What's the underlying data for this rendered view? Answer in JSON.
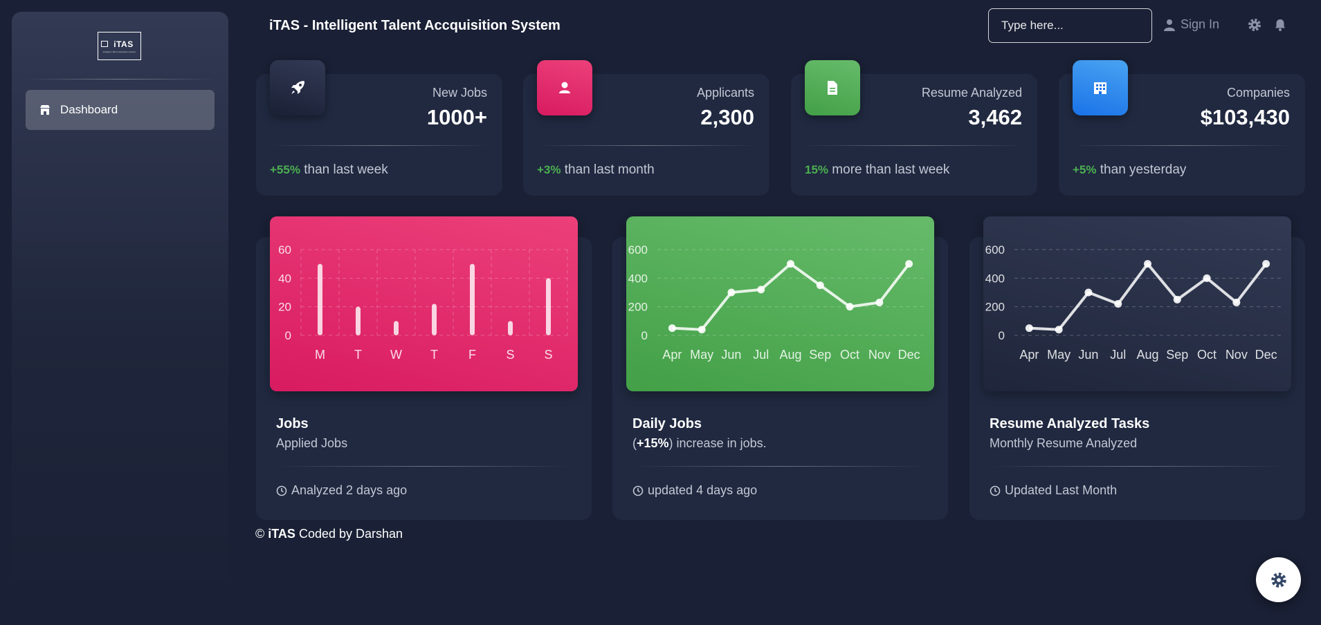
{
  "sidebar": {
    "logo_text": "iTAS",
    "logo_subtext": "Intelligent Talent Acquisition System",
    "items": [
      {
        "label": "Dashboard",
        "icon": "shop-icon",
        "active": true
      }
    ]
  },
  "header": {
    "title": "iTAS - Intelligent Talent Accquisition System",
    "search_placeholder": "Type here...",
    "signin_label": "Sign In",
    "icons": [
      "user-icon",
      "gear-icon",
      "bell-icon"
    ]
  },
  "stats": [
    {
      "label": "New Jobs",
      "value": "1000+",
      "pct": "+55%",
      "foot": " than last week",
      "icon": "rocket-icon",
      "color": "#2a3044"
    },
    {
      "label": "Applicants",
      "value": "2,300",
      "pct": "+3%",
      "foot": " than last month",
      "icon": "person-icon",
      "color": "#e91e63"
    },
    {
      "label": "Resume Analyzed",
      "value": "3,462",
      "pct": "15%",
      "foot": " more than last week",
      "icon": "document-icon",
      "color": "#4caf50"
    },
    {
      "label": "Companies",
      "value": "$103,430",
      "pct": "+5%",
      "foot": " than yesterday",
      "icon": "building-icon",
      "color": "#1a73e8"
    }
  ],
  "charts": [
    {
      "title": "Jobs",
      "subtitle": "Applied Jobs",
      "footer": "Analyzed 2 days ago"
    },
    {
      "title": "Daily Jobs",
      "subtitle_pre": "(",
      "subtitle_bold": "+15%",
      "subtitle_post": ") increase in jobs.",
      "footer": "updated 4 days ago"
    },
    {
      "title": "Resume Analyzed Tasks",
      "subtitle": "Monthly Resume Analyzed",
      "footer": "Updated Last Month"
    }
  ],
  "chart_data": [
    {
      "type": "bar",
      "categories": [
        "M",
        "T",
        "W",
        "T",
        "F",
        "S",
        "S"
      ],
      "values": [
        50,
        20,
        10,
        22,
        50,
        10,
        40
      ],
      "ylim": [
        0,
        60
      ],
      "yticks": [
        0,
        20,
        40,
        60
      ],
      "background": "#e91e63"
    },
    {
      "type": "line",
      "categories": [
        "Apr",
        "May",
        "Jun",
        "Jul",
        "Aug",
        "Sep",
        "Oct",
        "Nov",
        "Dec"
      ],
      "values": [
        50,
        40,
        300,
        320,
        500,
        350,
        200,
        230,
        500
      ],
      "ylim": [
        0,
        600
      ],
      "yticks": [
        0,
        200,
        400,
        600
      ],
      "background": "#4caf50"
    },
    {
      "type": "line",
      "categories": [
        "Apr",
        "May",
        "Jun",
        "Jul",
        "Aug",
        "Sep",
        "Oct",
        "Nov",
        "Dec"
      ],
      "values": [
        50,
        40,
        300,
        220,
        500,
        250,
        400,
        230,
        500
      ],
      "ylim": [
        0,
        600
      ],
      "yticks": [
        0,
        200,
        400,
        600
      ],
      "background": "#2a3148"
    }
  ],
  "footer": {
    "copyright": "© ",
    "brand": "iTAS",
    "text": " Coded by Darshan"
  },
  "fab": {
    "icon": "gear-icon"
  }
}
